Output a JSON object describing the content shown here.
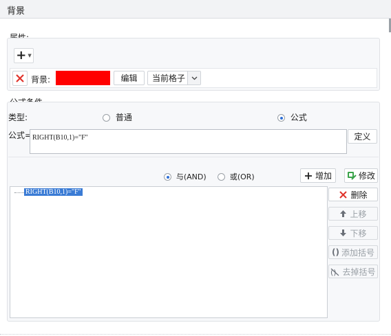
{
  "window": {
    "title": "背景"
  },
  "properties": {
    "section_label": "属性:",
    "add_button_glyph": "+",
    "row": {
      "label": "背景:",
      "color": "#ff0000",
      "edit_button": "编辑",
      "scope_value": "当前格子"
    }
  },
  "condition": {
    "section_label": "公式条件",
    "type_label": "类型:",
    "type_options": [
      {
        "label": "普通",
        "selected": false
      },
      {
        "label": "公式",
        "selected": true
      }
    ],
    "formula_label": "公式=",
    "formula_value": "RIGHT(B10,1)=\"F\"",
    "define_button": "定义",
    "logic_options": [
      {
        "label": "与(AND)",
        "selected": true
      },
      {
        "label": "或(OR)",
        "selected": false
      }
    ],
    "add_button": "增加",
    "modify_button": "修改",
    "tree_items": [
      "RIGHT(B10,1)=\"F\""
    ],
    "side_buttons": {
      "delete": "删除",
      "move_up": "上移",
      "move_down": "下移",
      "add_paren": "添加括号",
      "remove_paren": "去掉括号"
    }
  },
  "colors": {
    "accent": "#2f6fd6",
    "selection": "#3a7bd5",
    "delete_red": "#e0332b",
    "green": "#3aa34a"
  }
}
